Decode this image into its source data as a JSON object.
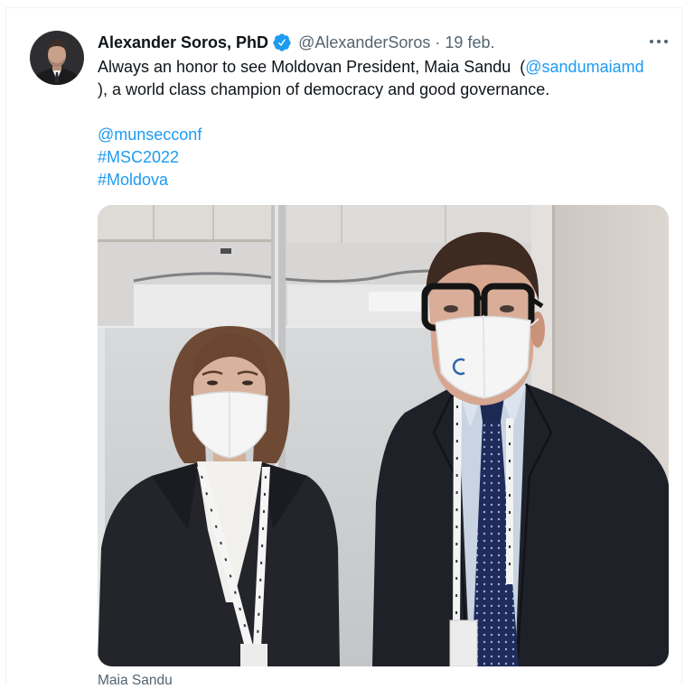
{
  "tweet": {
    "author": {
      "name": "Alexander Soros, PhD",
      "handle": "@AlexanderSoros",
      "verified": true
    },
    "separator": "·",
    "date": "19 feb.",
    "text": {
      "line1_prefix": "Always an honor to see Moldovan President, Maia Sandu  (",
      "mention": "@sandumaiamd",
      "line2": "), a world class champion of democracy and good governance."
    },
    "tags": [
      "@munsecconf",
      "#MSC2022",
      "#Moldova"
    ],
    "media": {
      "tagged_people": [
        "Maia Sandu"
      ]
    }
  },
  "icons": {
    "verified": "verified-badge-icon",
    "more": "more-icon"
  },
  "colors": {
    "accent": "#1d9bf0",
    "text": "#0f1419",
    "secondary": "#536471",
    "border": "#eff3f4"
  }
}
